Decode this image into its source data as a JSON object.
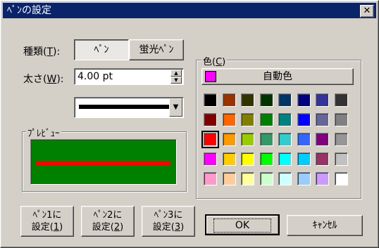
{
  "window": {
    "title": "ﾍﾟﾝの設定",
    "close_glyph": "✕"
  },
  "kind": {
    "label": "種類(",
    "key": "T",
    "suffix": "):",
    "pen_btn": "ﾍﾟﾝ",
    "marker_btn": "蛍光ﾍﾟﾝ"
  },
  "thickness": {
    "label": "太さ(",
    "key": "W",
    "suffix": "):",
    "value": "4.00 pt"
  },
  "preview": {
    "label": "ﾌﾟﾚﾋﾞｭｰ",
    "bg_color": "#008000",
    "line_color": "#ff0000"
  },
  "color": {
    "label": "色(",
    "key": "C",
    "suffix": ")",
    "auto_label": "自動色",
    "auto_color": "#ff00ff",
    "palette": [
      [
        "#000000",
        "#993300",
        "#333300",
        "#003300",
        "#003366",
        "#000080",
        "#333399",
        "#333333"
      ],
      [
        "#800000",
        "#ff6600",
        "#808000",
        "#008000",
        "#008080",
        "#0000ff",
        "#666699",
        "#808080"
      ],
      [
        "#ff0000",
        "#ff9900",
        "#99cc00",
        "#339966",
        "#33cccc",
        "#3366ff",
        "#800080",
        "#969696"
      ],
      [
        "#ff00ff",
        "#ffcc00",
        "#ffff00",
        "#00ff00",
        "#00ffff",
        "#00ccff",
        "#993366",
        "#c0c0c0"
      ],
      [
        "#ff99cc",
        "#ffcc99",
        "#ffff99",
        "#ccffcc",
        "#ccffff",
        "#99ccff",
        "#cc99ff",
        "#ffffff"
      ]
    ],
    "selected": [
      2,
      0
    ]
  },
  "presets": [
    {
      "line1": "ﾍﾟﾝ1に",
      "line2a": "設定(",
      "key": "1",
      "line2b": ")"
    },
    {
      "line1": "ﾍﾟﾝ2に",
      "line2a": "設定(",
      "key": "2",
      "line2b": ")"
    },
    {
      "line1": "ﾍﾟﾝ3に",
      "line2a": "設定(",
      "key": "3",
      "line2b": ")"
    }
  ],
  "ok_label": "OK",
  "cancel_label": "ｷｬﾝｾﾙ"
}
